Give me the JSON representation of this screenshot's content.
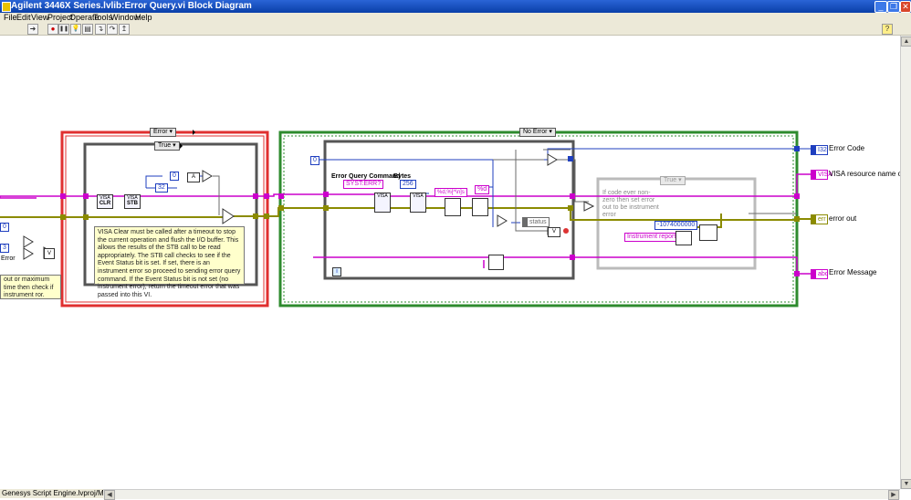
{
  "window": {
    "title": "Agilent 3446X Series.lvlib:Error Query.vi Block Diagram",
    "minimize_glyph": "_",
    "restore_glyph": "❐",
    "close_glyph": "✕",
    "app_icon": "labview-vi-icon"
  },
  "menu": [
    "File",
    "Edit",
    "View",
    "Project",
    "Operate",
    "Tools",
    "Window",
    "Help"
  ],
  "toolbar": {
    "run_glyph": "➜",
    "abort_glyph": "●",
    "pause_glyph": "❚❚",
    "highlight_glyph": "💡",
    "retain_glyph": "▤",
    "step_into_glyph": "↴",
    "step_over_glyph": "↷",
    "step_out_glyph": "↥",
    "help_glyph": "?"
  },
  "diagram": {
    "outer_case_left_selector": "Error",
    "inner_case_left_selector": "True",
    "outer_case_right_selector": "No Error",
    "inner_case_right_selector": "True",
    "left_partial_comment": "out or maximum time then check if instrument ror.",
    "left_partial_label": "Error",
    "left_partial_num1": "0",
    "left_partial_num2": "3",
    "clr_label": "CLR",
    "stb_label": "STB",
    "visa_small": "VISA",
    "const_32": "32",
    "const_0": "0",
    "gate_a_label": "A",
    "comment_main": "VISA Clear must be called after a timeout to stop the current operation and flush the I/O buffer. This allows the results of the STB call to be read appropriately. The STB call checks to see if the Event Status bit is set.  If set, there is an instrument error so proceed to sending error query command.  If the Event Status bit is not set (no instrument error), return the timeout error that was passed into this VI.",
    "error_query_label": "Error Query Command",
    "bytes_label": "Bytes",
    "syst_err_value": "SYST:ERR?",
    "bytes_value": "256",
    "scan_format": "%d,%[^\\n]s",
    "fmt_d": "%d",
    "status_label": "status",
    "code_comment": "If code ever non-zero then set error out to be instrument error",
    "error_code_value": "-1074000000",
    "instrument_reports": "Instrument reports:",
    "info_glyph": "i",
    "zero_left": "0",
    "v_label": "V",
    "outputs": {
      "error_code": {
        "label": "Error Code",
        "type": "I32"
      },
      "visa_out": {
        "label": "VISA resource name out",
        "type": "VISA"
      },
      "error_out": {
        "label": "error out",
        "type": "err"
      },
      "error_message": {
        "label": "Error Message",
        "type": "abc"
      }
    }
  },
  "status_bar": {
    "path": "Genesys Script Engine.lvproj/My Computer"
  },
  "colors": {
    "wire_pink": "#cc00cc",
    "wire_cluster": "#8b8b00",
    "wire_blue": "#1f3fbf",
    "wire_gray": "#6b6b6b",
    "case_red": "#e03030",
    "case_green": "#2e8b2e",
    "comment_bg": "#ffffcc"
  }
}
